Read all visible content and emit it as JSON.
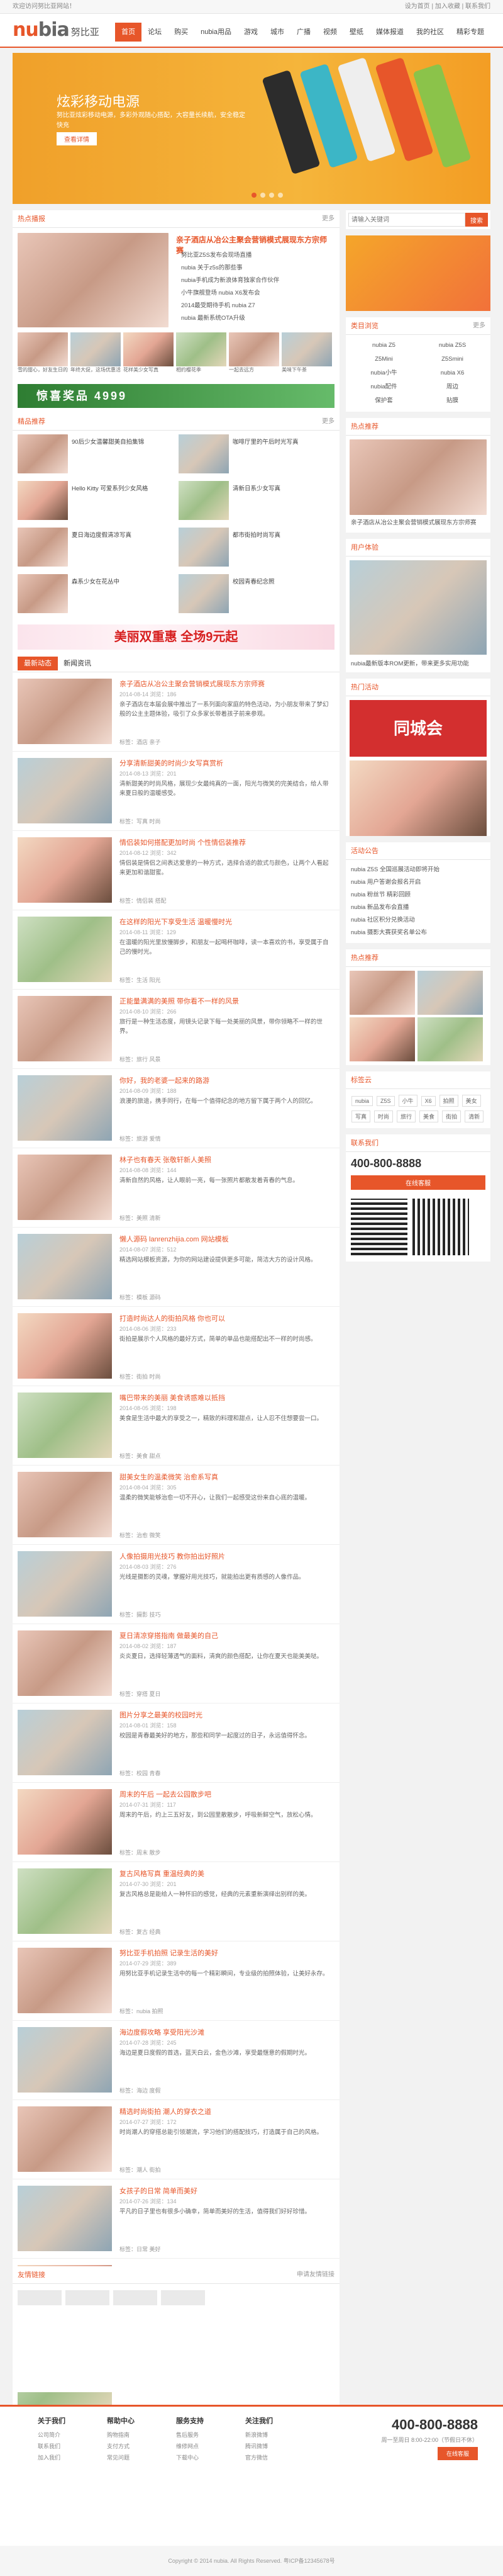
{
  "topbar": {
    "left": "欢迎访问努比亚网站！",
    "right": "设为首页 | 加入收藏 | 联系我们"
  },
  "logo": {
    "mark": "nubia",
    "text": "努比亚"
  },
  "nav": [
    "首页",
    "论坛",
    "购买",
    "nubia用品",
    "游戏",
    "城市",
    "广播",
    "视频",
    "壁纸",
    "媒体报道",
    "我的社区",
    "精彩专题"
  ],
  "banner": {
    "title": "炫彩移动电源",
    "sub": "努比亚炫彩移动电源，多彩外观随心搭配，大容量长续航，安全稳定快充",
    "btn": "查看详情"
  },
  "hot": {
    "title": "热点播报",
    "more": "更多",
    "headline": "亲子酒店从冶公主聚会营销模式展现东方宗师赛",
    "items": [
      "努比亚Z5S发布会现场直播",
      "nubia  关于z5s的那些事",
      "nubia手机成为新浪体育独家合作伙伴",
      "小牛旗舰登场 nubia X6发布会",
      "2014最受期待手机 nubia Z7",
      "nubia 最新系统OTA升级"
    ],
    "caps": [
      "雪的甜心，好友生日的惊喜",
      "年终大促，这场优惠活动值得关注",
      "花样美少女写真",
      "相约樱花季",
      "一起去远方",
      "美味下午茶"
    ]
  },
  "rec": {
    "title": "精品推荐",
    "items": [
      "90后少女温馨甜美自拍集锦",
      "咖啡厅里的午后时光写真",
      "Hello Kitty  可爱系列少女风格",
      "清新日系少女写真",
      "夏日海边度假清凉写真",
      "都市街拍时尚写真",
      "森系少女在花丛中",
      "校园青春纪念照"
    ]
  },
  "ad_green": "惊喜奖品  4999",
  "ad_pink": "美丽双重惠 全场9元起",
  "news": {
    "tabs": [
      "最新动态",
      "新闻资讯"
    ],
    "articles": [
      {
        "title": "亲子酒店从冶公主聚会营销模式展现东方宗师赛",
        "meta": "2014-08-14  浏览：186",
        "desc": "亲子酒店在本届会展中推出了一系列面向家庭的特色活动，为小朋友带来了梦幻般的公主主题体验，吸引了众多家长带着孩子前来参观。",
        "tags": "标签：酒店  亲子"
      },
      {
        "title": "分享清新甜美的时尚少女写真赏析",
        "meta": "2014-08-13  浏览：201",
        "desc": "清新甜美的时尚风格，展现少女最纯真的一面，阳光与微笑的完美结合，给人带来夏日般的温暖感受。",
        "tags": "标签：写真  时尚"
      },
      {
        "title": "情侣装如何搭配更加时尚 个性情侣装推荐",
        "meta": "2014-08-12  浏览：342",
        "desc": "情侣装是情侣之间表达爱意的一种方式，选择合适的款式与颜色，让两个人看起来更加和谐甜蜜。",
        "tags": "标签：情侣装  搭配"
      },
      {
        "title": "在这样的阳光下享受生活 温暖慢时光",
        "meta": "2014-08-11  浏览：129",
        "desc": "在温暖的阳光里放慢脚步，和朋友一起喝杯咖啡，读一本喜欢的书，享受属于自己的慢时光。",
        "tags": "标签：生活  阳光"
      },
      {
        "title": "正能量满满的美照 带你看不一样的风景",
        "meta": "2014-08-10  浏览：266",
        "desc": "旅行是一种生活态度，用镜头记录下每一处美丽的风景，带你领略不一样的世界。",
        "tags": "标签：旅行  风景"
      },
      {
        "title": "你好，我的老婆一起来的路游",
        "meta": "2014-08-09  浏览：188",
        "desc": "浪漫的旅途，携手同行，在每一个值得纪念的地方留下属于两个人的回忆。",
        "tags": "标签：旅游  爱情"
      },
      {
        "title": "林子也有春天 张敬轩新人美照",
        "meta": "2014-08-08  浏览：144",
        "desc": "清新自然的风格，让人眼前一亮，每一张照片都散发着青春的气息。",
        "tags": "标签：美照  清新"
      },
      {
        "title": "懒人源码 lanrenzhijia.com 网站模板",
        "meta": "2014-08-07  浏览：512",
        "desc": "精选网站模板资源，为你的网站建设提供更多可能，简洁大方的设计风格。",
        "tags": "标签：模板  源码"
      },
      {
        "title": "打造时尚达人的街拍风格 你也可以",
        "meta": "2014-08-06  浏览：233",
        "desc": "街拍是展示个人风格的最好方式，简单的单品也能搭配出不一样的时尚感。",
        "tags": "标签：街拍  时尚"
      },
      {
        "title": "嘴巴带来的美丽 美食诱惑难以抵挡",
        "meta": "2014-08-05  浏览：198",
        "desc": "美食是生活中最大的享受之一，精致的料理和甜点，让人忍不住想要尝一口。",
        "tags": "标签：美食  甜点"
      },
      {
        "title": "甜美女生的温柔微笑 治愈系写真",
        "meta": "2014-08-04  浏览：305",
        "desc": "温柔的微笑能够治愈一切不开心，让我们一起感受这份来自心底的温暖。",
        "tags": "标签：治愈  微笑"
      },
      {
        "title": "人像拍摄用光技巧 教你拍出好照片",
        "meta": "2014-08-03  浏览：276",
        "desc": "光线是摄影的灵魂，掌握好用光技巧，就能拍出更有质感的人像作品。",
        "tags": "标签：摄影  技巧"
      },
      {
        "title": "夏日清凉穿搭指南 做最美的自己",
        "meta": "2014-08-02  浏览：187",
        "desc": "炎炎夏日，选择轻薄透气的面料，清爽的颜色搭配，让你在夏天也能美美哒。",
        "tags": "标签：穿搭  夏日"
      },
      {
        "title": "图片分享之最美的校园时光",
        "meta": "2014-08-01  浏览：158",
        "desc": "校园是青春最美好的地方，那些和同学一起度过的日子，永远值得怀念。",
        "tags": "标签：校园  青春"
      },
      {
        "title": "周末的午后 一起去公园散步吧",
        "meta": "2014-07-31  浏览：117",
        "desc": "周末的午后，约上三五好友，到公园里散散步，呼吸新鲜空气，放松心情。",
        "tags": "标签：周末  散步"
      },
      {
        "title": "复古风格写真 重温经典的美",
        "meta": "2014-07-30  浏览：201",
        "desc": "复古风格总是能给人一种怀旧的感觉，经典的元素重新演绎出别样的美。",
        "tags": "标签：复古  经典"
      },
      {
        "title": "努比亚手机拍照 记录生活的美好",
        "meta": "2014-07-29  浏览：389",
        "desc": "用努比亚手机记录生活中的每一个精彩瞬间，专业级的拍照体验，让美好永存。",
        "tags": "标签：nubia  拍照"
      },
      {
        "title": "海边度假攻略 享受阳光沙滩",
        "meta": "2014-07-28  浏览：245",
        "desc": "海边是夏日度假的首选，蓝天白云，金色沙滩，享受最惬意的假期时光。",
        "tags": "标签：海边  度假"
      },
      {
        "title": "精选时尚街拍 潮人的穿衣之道",
        "meta": "2014-07-27  浏览：172",
        "desc": "时尚潮人的穿搭总能引领潮流，学习他们的搭配技巧，打造属于自己的风格。",
        "tags": "标签：潮人  街拍"
      },
      {
        "title": "女孩子的日常 简单而美好",
        "meta": "2014-07-26  浏览：134",
        "desc": "平凡的日子里也有很多小确幸，简单而美好的生活，值得我们好好珍惜。",
        "tags": "标签：日常  美好"
      },
      {
        "title": "秋天的第一杯奶茶 温暖你的心",
        "meta": "2014-07-25  浏览：223",
        "desc": "秋天来了，一杯温暖的奶茶，驱散秋日的凉意，也温暖了每一个人的心。",
        "tags": "标签：秋天  奶茶"
      },
      {
        "title": "阳光下的笑脸 最真实的自己",
        "meta": "2014-07-24  浏览：161",
        "desc": "在阳光下绽放最灿烂的笑容，做最真实的自己，活出精彩的人生。",
        "tags": "标签：阳光  笑脸"
      }
    ]
  },
  "links": {
    "title": "友情链接",
    "more": "申请友情链接"
  },
  "sidebar": {
    "search_placeholder": "请输入关键词",
    "search_btn": "搜索",
    "cat_title": "类目浏览",
    "cat_more": "更多",
    "cats": [
      "nubia Z5",
      "nubia Z5S",
      "Z5Mini",
      "Z5Smini",
      "nubia小牛",
      "nubia X6",
      "nubia配件",
      "周边",
      "保护套",
      "贴膜"
    ],
    "hot_title": "热点推荐",
    "hot_cap": "亲子酒店从冶公主聚会营销模式展现东方宗师赛",
    "fav_title": "用户体验",
    "fav": "nubia最新版本ROM更新，带来更多实用功能",
    "city_title": "热门活动",
    "city_ad": "同城会",
    "ann_title": "活动公告",
    "ann": [
      "nubia Z5S 全国巡展活动即将开始",
      "nubia 用户答谢会报名开启",
      "nubia 粉丝节 精彩回顾",
      "nubia 新品发布会直播",
      "nubia 社区积分兑换活动",
      "nubia 摄影大赛获奖名单公布"
    ],
    "tag_title": "标签云",
    "tags": [
      "nubia",
      "Z5S",
      "小牛",
      "X6",
      "拍照",
      "美女",
      "写真",
      "时尚",
      "旅行",
      "美食",
      "街拍",
      "清新"
    ],
    "contact_title": "联系我们",
    "phone": "400-800-8888",
    "qq": "在线客服"
  },
  "footer": {
    "cols": [
      {
        "h": "关于我们",
        "items": [
          "公司简介",
          "联系我们",
          "加入我们"
        ]
      },
      {
        "h": "帮助中心",
        "items": [
          "购物指南",
          "支付方式",
          "常见问题"
        ]
      },
      {
        "h": "服务支持",
        "items": [
          "售后服务",
          "维修网点",
          "下载中心"
        ]
      },
      {
        "h": "关注我们",
        "items": [
          "新浪微博",
          "腾讯微博",
          "官方微信"
        ]
      }
    ],
    "tel": "400-800-8888",
    "tel_sub": "周一至周日 8:00-22:00（节假日不休）",
    "tel_btn": "在线客服",
    "copy": "Copyright © 2014 nubia. All Rights Reserved. 粤ICP备12345678号"
  },
  "colors": {
    "accent": "#e7562a"
  }
}
